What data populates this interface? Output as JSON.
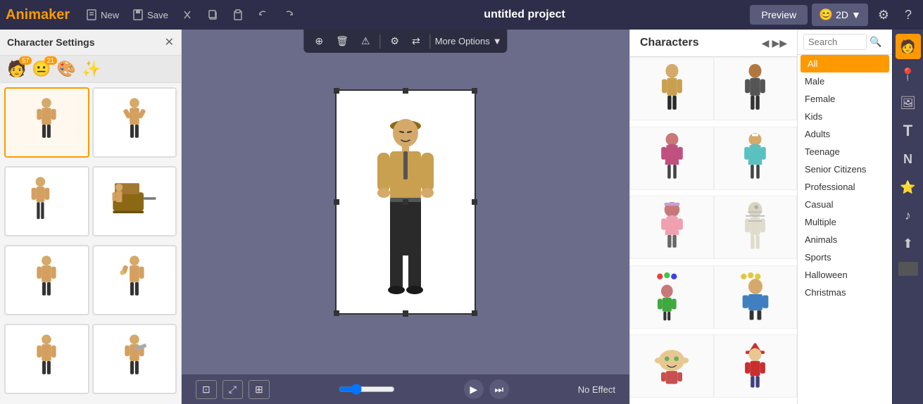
{
  "app": {
    "brand": "Animaker",
    "title": "untitled project",
    "preview_btn": "Preview",
    "view_mode": "2D"
  },
  "toolbar": {
    "new_label": "New",
    "save_label": "Save",
    "cut_label": "",
    "copy_label": "",
    "paste_label": "",
    "undo_label": "",
    "redo_label": ""
  },
  "left_panel": {
    "title": "Character Settings",
    "tab_poses_count": "57",
    "tab_faces_count": "21"
  },
  "canvas": {
    "more_options_label": "More Options",
    "no_effect": "No Effect"
  },
  "characters_panel": {
    "title": "Characters"
  },
  "filter": {
    "search_placeholder": "Search",
    "items": [
      {
        "id": "all",
        "label": "All",
        "active": true
      },
      {
        "id": "male",
        "label": "Male",
        "active": false
      },
      {
        "id": "female",
        "label": "Female",
        "active": false
      },
      {
        "id": "kids",
        "label": "Kids",
        "active": false
      },
      {
        "id": "adults",
        "label": "Adults",
        "active": false
      },
      {
        "id": "teenage",
        "label": "Teenage",
        "active": false
      },
      {
        "id": "senior-citizens",
        "label": "Senior Citizens",
        "active": false
      },
      {
        "id": "professional",
        "label": "Professional",
        "active": false
      },
      {
        "id": "casual",
        "label": "Casual",
        "active": false
      },
      {
        "id": "multiple",
        "label": "Multiple",
        "active": false
      },
      {
        "id": "animals",
        "label": "Animals",
        "active": false
      },
      {
        "id": "sports",
        "label": "Sports",
        "active": false
      },
      {
        "id": "halloween",
        "label": "Halloween",
        "active": false
      },
      {
        "id": "christmas",
        "label": "Christmas",
        "active": false
      }
    ]
  }
}
